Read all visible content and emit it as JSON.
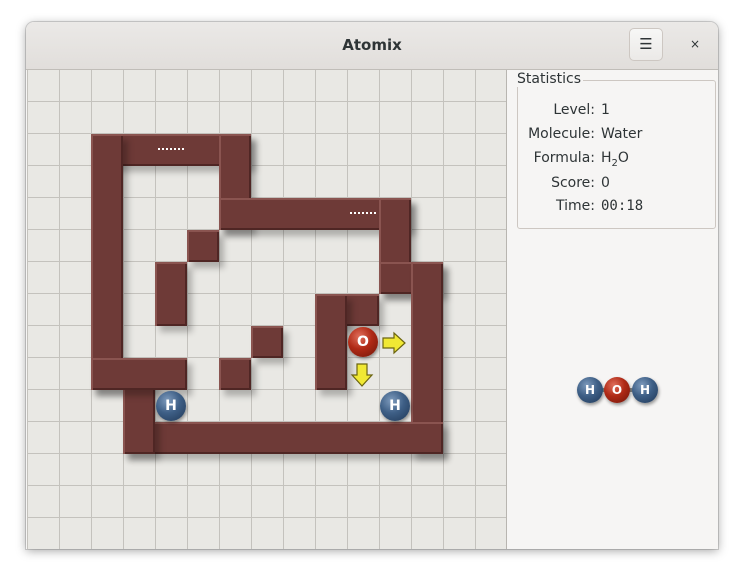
{
  "window": {
    "title": "Atomix"
  },
  "header": {
    "menu_label": "☰",
    "close_label": "×"
  },
  "board": {
    "grid": "15x15",
    "atoms": [
      {
        "symbol": "H",
        "color": "#3e5f86"
      },
      {
        "symbol": "O",
        "color": "#b02a16"
      },
      {
        "symbol": "H",
        "color": "#3e5f86"
      }
    ],
    "arrows": [
      "right",
      "down"
    ],
    "arrow_color": "#f0e834",
    "wall_color": "#6e3a37"
  },
  "statistics": {
    "title": "Statistics",
    "level_label": "Level:",
    "level": "1",
    "molecule_label": "Molecule:",
    "molecule": "Water",
    "formula_label": "Formula:",
    "formula_main": "H",
    "formula_sub": "2",
    "formula_tail": "O",
    "score_label": "Score:",
    "score": "0",
    "time_label": "Time:",
    "time": "00:18"
  },
  "preview": {
    "atoms": [
      "H",
      "O",
      "H"
    ]
  }
}
